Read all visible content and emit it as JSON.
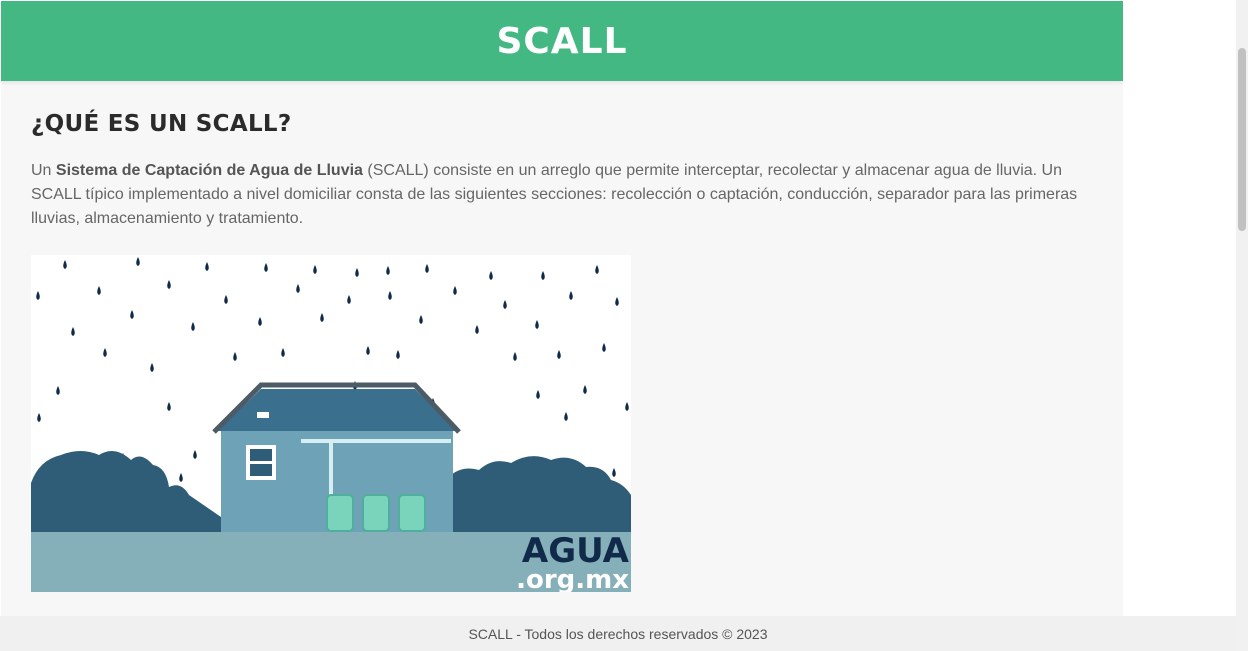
{
  "header": {
    "title": "SCALL"
  },
  "main": {
    "heading": "¿QUÉ ES UN SCALL?",
    "paragraph": {
      "prefix": "Un ",
      "bold": "Sistema de Captación de Agua de Lluvia",
      "suffix": " (SCALL) consiste en un arreglo que permite interceptar, recolectar y almacenar agua de lluvia. Un SCALL típico implementado a nivel domiciliar consta de las siguientes secciones: recolección o captación, conducción, separador para las primeras lluvias, almacenamiento y tratamiento."
    },
    "image": {
      "logo_line1": "AGUA",
      "logo_line2": ".org.mx",
      "icon": "house-rainwater-illustration"
    }
  },
  "footer": {
    "text": "SCALL - Todos los derechos reservados © 2023"
  },
  "colors": {
    "header_bg": "#43b883",
    "page_bg": "#f7f7f7",
    "raindrop": "#0f2a4a",
    "bushes": "#2f5d78",
    "ground": "#85b0ba",
    "house": "#6ea3b7"
  }
}
